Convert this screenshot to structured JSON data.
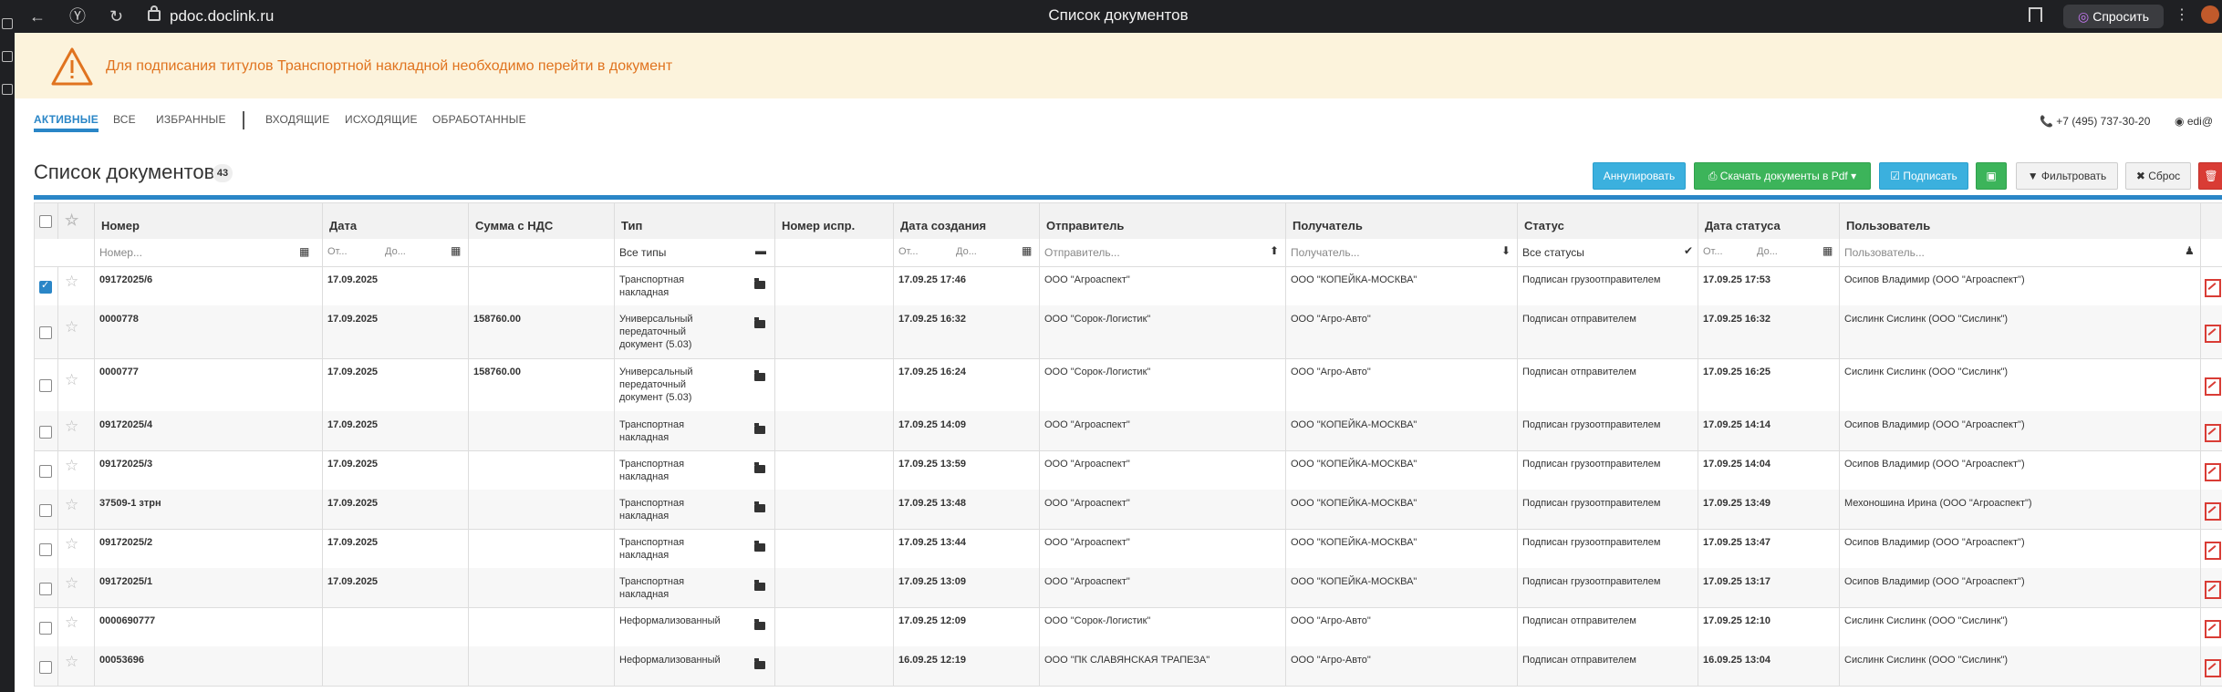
{
  "browser": {
    "url": "pdoc.doclink.ru",
    "title": "Список документов",
    "ask_label": "Спросить",
    "kebab": "⋮"
  },
  "warning": {
    "message": "Для подписания титулов Транспортной накладной необходимо перейти в документ"
  },
  "tabs": [
    {
      "label": "АКТИВНЫЕ",
      "active": true
    },
    {
      "label": "ВСЕ"
    },
    {
      "label": "ИЗБРАННЫЕ"
    },
    {
      "label": "ВХОДЯЩИЕ"
    },
    {
      "label": "ИСХОДЯЩИЕ"
    },
    {
      "label": "ОБРАБОТАННЫЕ"
    }
  ],
  "header": {
    "phone": "+7 (495) 737-30-20",
    "user": "edi@"
  },
  "page": {
    "title": "Список документов",
    "count": "43"
  },
  "toolbar": {
    "annul": "Аннулировать",
    "download_pdf": "Скачать документы в Pdf",
    "sign": "Подписать",
    "filter": "Фильтровать",
    "reset": "Сброс"
  },
  "columns": [
    "Номер",
    "Дата",
    "Сумма с НДС",
    "Тип",
    "Номер испр.",
    "Дата создания",
    "Отправитель",
    "Получатель",
    "Статус",
    "Дата статуса",
    "Пользователь"
  ],
  "filters": {
    "number_ph": "Номер...",
    "from_ph": "От...",
    "to_ph": "До...",
    "type_value": "Все типы",
    "sender_ph": "Отправитель...",
    "receiver_ph": "Получатель...",
    "status_value": "Все статусы",
    "user_ph": "Пользователь..."
  },
  "rows": [
    {
      "number": "09172025/6",
      "date": "17.09.2025",
      "sum": "",
      "type": "Транспортная\nнакладная",
      "fix": "",
      "created": "17.09.25 17:46",
      "sender": "ООО \"Агроаспект\"",
      "receiver": "ООО \"КОПЕЙКА-МОСКВА\"",
      "status": "Подписан грузоотправителем",
      "status_date": "17.09.25 17:53",
      "user": "Осипов Владимир (ООО \"Агроаспект\")",
      "checked": true
    },
    {
      "number": "0000778",
      "date": "17.09.2025",
      "sum": "158760.00",
      "type": "Универсальный\nпередаточный\nдокумент (5.03)",
      "fix": "",
      "created": "17.09.25 16:32",
      "sender": "ООО \"Сорок-Логистик\"",
      "receiver": "ООО \"Агро-Авто\"",
      "status": "Подписан отправителем",
      "status_date": "17.09.25 16:32",
      "user": "Сислинк Сислинк (ООО \"Сислинк\")"
    },
    {
      "number": "0000777",
      "date": "17.09.2025",
      "sum": "158760.00",
      "type": "Универсальный\nпередаточный\nдокумент (5.03)",
      "fix": "",
      "created": "17.09.25 16:24",
      "sender": "ООО \"Сорок-Логистик\"",
      "receiver": "ООО \"Агро-Авто\"",
      "status": "Подписан отправителем",
      "status_date": "17.09.25 16:25",
      "user": "Сислинк Сислинк (ООО \"Сислинк\")"
    },
    {
      "number": "09172025/4",
      "date": "17.09.2025",
      "sum": "",
      "type": "Транспортная\nнакладная",
      "fix": "",
      "created": "17.09.25 14:09",
      "sender": "ООО \"Агроаспект\"",
      "receiver": "ООО \"КОПЕЙКА-МОСКВА\"",
      "status": "Подписан грузоотправителем",
      "status_date": "17.09.25 14:14",
      "user": "Осипов Владимир (ООО \"Агроаспект\")"
    },
    {
      "number": "09172025/3",
      "date": "17.09.2025",
      "sum": "",
      "type": "Транспортная\nнакладная",
      "fix": "",
      "created": "17.09.25 13:59",
      "sender": "ООО \"Агроаспект\"",
      "receiver": "ООО \"КОПЕЙКА-МОСКВА\"",
      "status": "Подписан грузоотправителем",
      "status_date": "17.09.25 14:04",
      "user": "Осипов Владимир (ООО \"Агроаспект\")"
    },
    {
      "number": "37509-1 зтрн",
      "date": "17.09.2025",
      "sum": "",
      "type": "Транспортная\nнакладная",
      "fix": "",
      "created": "17.09.25 13:48",
      "sender": "ООО \"Агроаспект\"",
      "receiver": "ООО \"КОПЕЙКА-МОСКВА\"",
      "status": "Подписан грузоотправителем",
      "status_date": "17.09.25 13:49",
      "user": "Мехоношина Ирина (ООО \"Агроаспект\")"
    },
    {
      "number": "09172025/2",
      "date": "17.09.2025",
      "sum": "",
      "type": "Транспортная\nнакладная",
      "fix": "",
      "created": "17.09.25 13:44",
      "sender": "ООО \"Агроаспект\"",
      "receiver": "ООО \"КОПЕЙКА-МОСКВА\"",
      "status": "Подписан грузоотправителем",
      "status_date": "17.09.25 13:47",
      "user": "Осипов Владимир (ООО \"Агроаспект\")"
    },
    {
      "number": "09172025/1",
      "date": "17.09.2025",
      "sum": "",
      "type": "Транспортная\nнакладная",
      "fix": "",
      "created": "17.09.25 13:09",
      "sender": "ООО \"Агроаспект\"",
      "receiver": "ООО \"КОПЕЙКА-МОСКВА\"",
      "status": "Подписан грузоотправителем",
      "status_date": "17.09.25 13:17",
      "user": "Осипов Владимир (ООО \"Агроаспект\")"
    },
    {
      "number": "0000690777",
      "date": "",
      "sum": "",
      "type": "Неформализованный",
      "fix": "",
      "created": "17.09.25 12:09",
      "sender": "ООО \"Сорок-Логистик\"",
      "receiver": "ООО \"Агро-Авто\"",
      "status": "Подписан отправителем",
      "status_date": "17.09.25 12:10",
      "user": "Сислинк Сислинк (ООО \"Сислинк\")"
    },
    {
      "number": "00053696",
      "date": "",
      "sum": "",
      "type": "Неформализованный",
      "fix": "",
      "created": "16.09.25 12:19",
      "sender": "ООО \"ПК СЛАВЯНСКАЯ ТРАПЕЗА\"",
      "receiver": "ООО \"Агро-Авто\"",
      "status": "Подписан отправителем",
      "status_date": "16.09.25 13:04",
      "user": "Сислинк Сислинк (ООО \"Сислинк\")"
    }
  ]
}
